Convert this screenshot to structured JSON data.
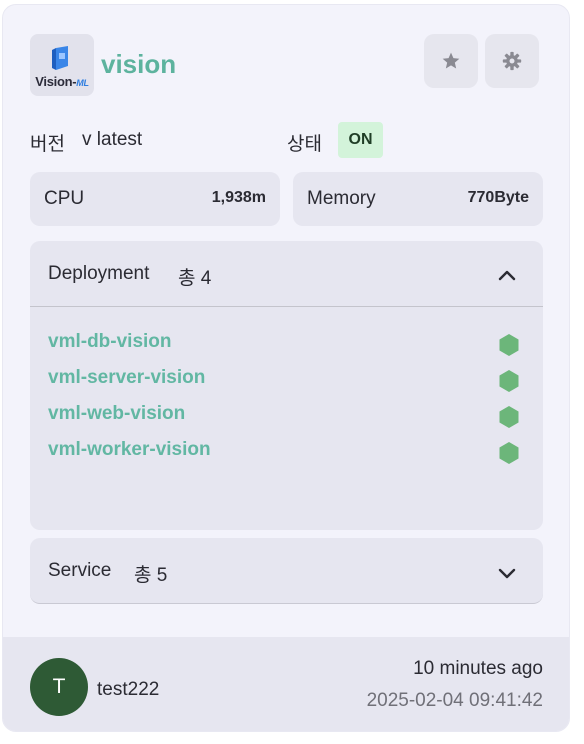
{
  "header": {
    "logo_text": "Vision-",
    "logo_suffix": "ML",
    "app_name": "vision"
  },
  "info": {
    "version_label": "버전",
    "version_value": "v latest",
    "status_label": "상태",
    "status_value": "ON"
  },
  "metrics": {
    "cpu_label": "CPU",
    "cpu_value": "1,938m",
    "memory_label": "Memory",
    "memory_value": "770Byte"
  },
  "deployment": {
    "title": "Deployment",
    "count": "총 4",
    "items": [
      {
        "name": "vml-db-vision"
      },
      {
        "name": "vml-server-vision"
      },
      {
        "name": "vml-web-vision"
      },
      {
        "name": "vml-worker-vision"
      }
    ]
  },
  "service": {
    "title": "Service",
    "count": "총 5"
  },
  "footer": {
    "avatar_initial": "T",
    "username": "test222",
    "relative_time": "10 minutes ago",
    "timestamp": "2025-02-04 09:41:42"
  },
  "colors": {
    "accent": "#5db39e",
    "status_badge_bg": "#d3f3da",
    "healthy": "#6cb67a",
    "avatar_bg": "#2e5a35"
  },
  "icons": {
    "favorite": "star-icon",
    "settings": "gear-icon",
    "deployment_toggle": "chevron-up-icon",
    "service_toggle": "chevron-down-icon",
    "deployment_status": "hexagon-icon"
  }
}
